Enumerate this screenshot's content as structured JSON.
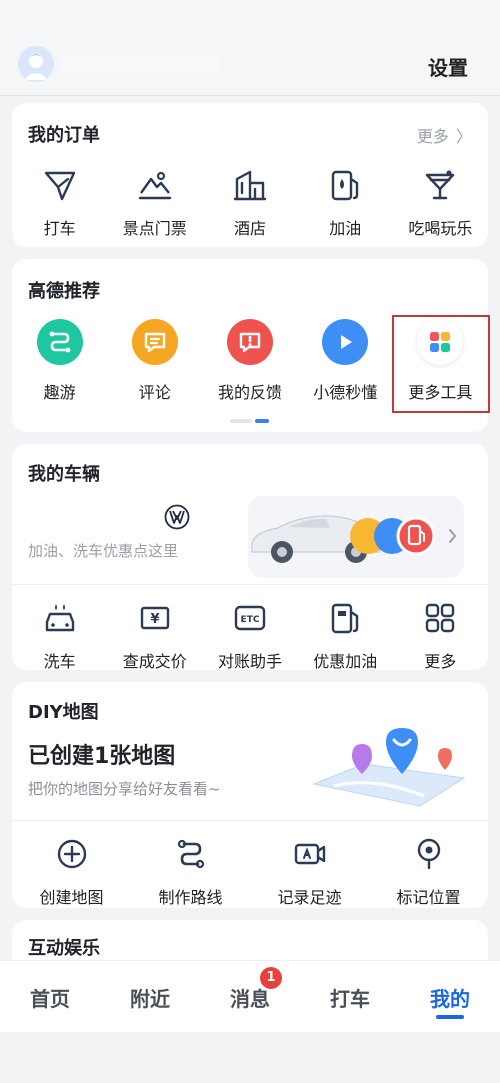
{
  "header": {
    "settings_label": "设置"
  },
  "orders": {
    "title": "我的订单",
    "more": "更多",
    "items": [
      {
        "label": "打车",
        "icon": "taxi-flag-icon"
      },
      {
        "label": "景点门票",
        "icon": "scenic-mountain-icon"
      },
      {
        "label": "酒店",
        "icon": "hotel-building-icon"
      },
      {
        "label": "加油",
        "icon": "fuel-pump-icon"
      },
      {
        "label": "吃喝玩乐",
        "icon": "cocktail-icon"
      }
    ]
  },
  "recommend": {
    "title": "高德推荐",
    "items": [
      {
        "label": "趣游",
        "icon": "route-icon",
        "color": "#1ec7a0"
      },
      {
        "label": "评论",
        "icon": "comment-icon",
        "color": "#f5a623"
      },
      {
        "label": "我的反馈",
        "icon": "feedback-icon",
        "color": "#ef5350"
      },
      {
        "label": "小德秒懂",
        "icon": "play-icon",
        "color": "#3d8ff5"
      },
      {
        "label": "更多工具",
        "icon": "grid-apps-icon",
        "color": "#ffffff"
      }
    ],
    "highlight_color": "#c5373d"
  },
  "vehicle": {
    "title": "我的车辆",
    "promo_text": "加油、洗车优惠点这里",
    "brand_icon": "volkswagen-logo-icon",
    "items": [
      {
        "label": "洗车",
        "icon": "car-wash-icon"
      },
      {
        "label": "查成交价",
        "icon": "price-tag-icon"
      },
      {
        "label": "对账助手",
        "icon": "etc-icon"
      },
      {
        "label": "优惠加油",
        "icon": "fuel-pump-icon"
      },
      {
        "label": "更多",
        "icon": "grid-icon"
      }
    ]
  },
  "diy": {
    "title": "DIY地图",
    "headline": "已创建1张地图",
    "subtitle": "把你的地图分享给好友看看~",
    "items": [
      {
        "label": "创建地图",
        "icon": "plus-circle-icon"
      },
      {
        "label": "制作路线",
        "icon": "route-icon"
      },
      {
        "label": "记录足迹",
        "icon": "video-camera-icon"
      },
      {
        "label": "标记位置",
        "icon": "location-pin-icon"
      }
    ]
  },
  "entertainment": {
    "title": "互动娱乐"
  },
  "tabbar": {
    "tabs": [
      {
        "label": "首页"
      },
      {
        "label": "附近"
      },
      {
        "label": "消息",
        "badge": "1"
      },
      {
        "label": "打车"
      },
      {
        "label": "我的"
      }
    ],
    "active_color": "#1a66e6"
  }
}
